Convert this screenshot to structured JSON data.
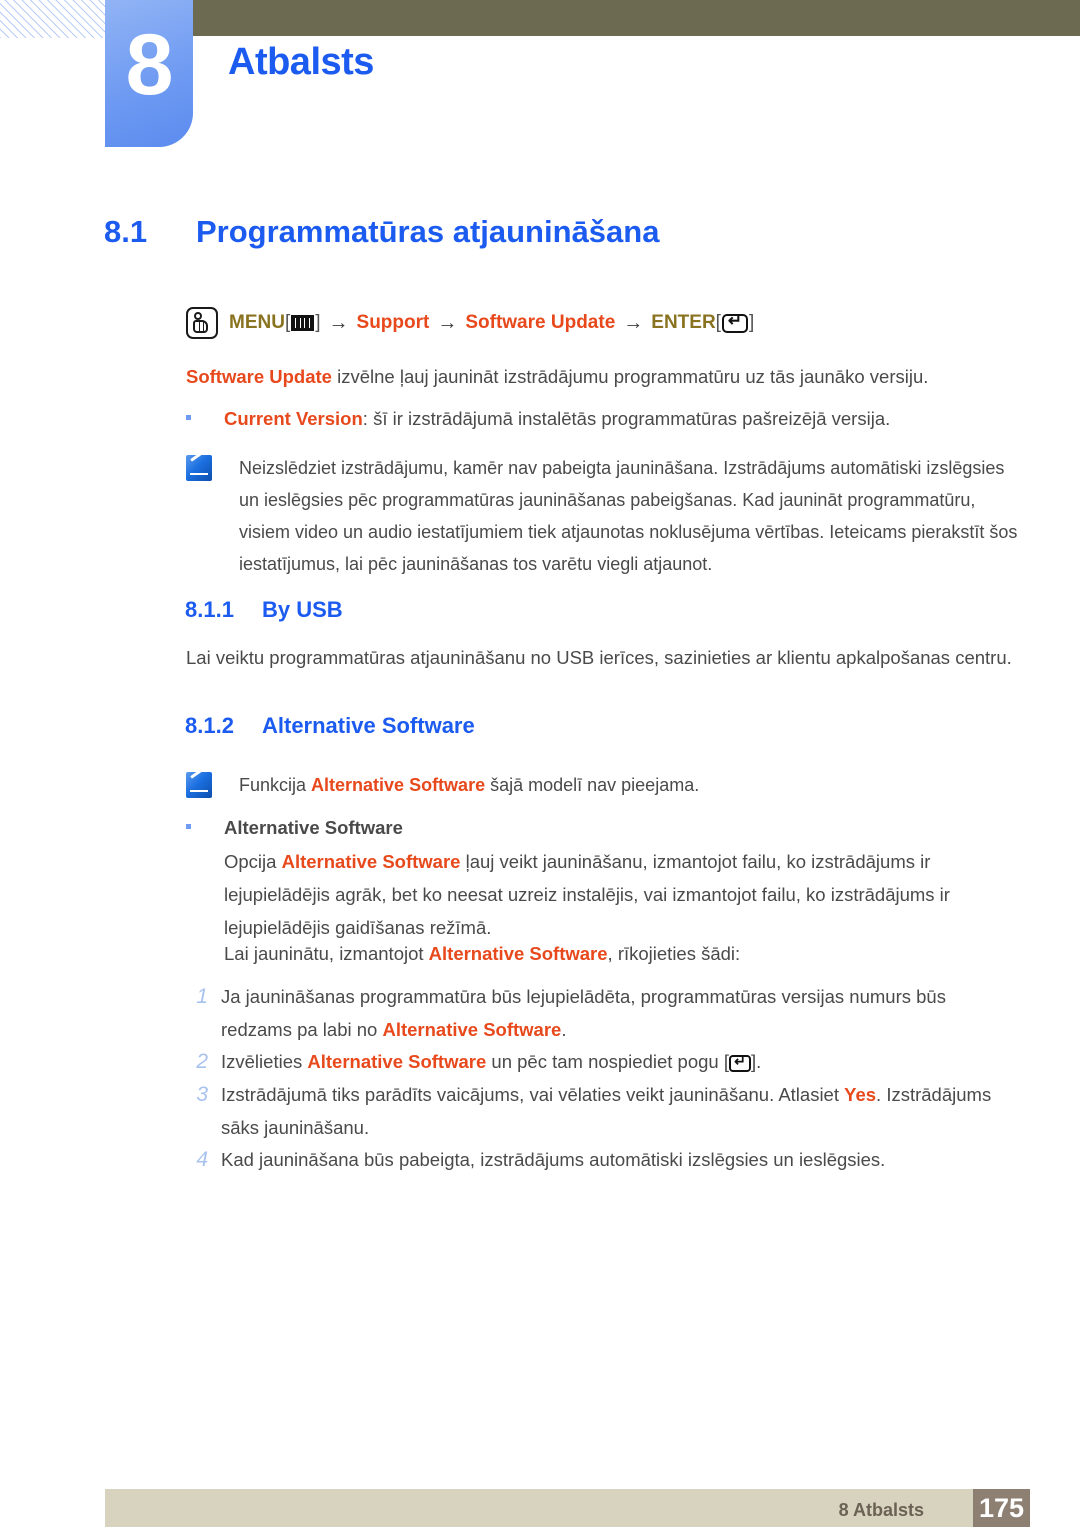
{
  "header": {
    "chapter_number": "8",
    "chapter_title": "Atbalsts"
  },
  "section": {
    "number": "8.1",
    "title": "Programmatūras atjaunināšana"
  },
  "menu_path": {
    "hand_icon": "hand-pointer-icon",
    "menu_label": "MENU",
    "menu_icon": "menu-bars-icon",
    "arrow": "→",
    "step1": "Support",
    "step2": "Software Update",
    "enter_label": "ENTER",
    "enter_icon": "enter-key-icon",
    "bracket_open": "[",
    "bracket_close": "]"
  },
  "intro": {
    "bold": "Software Update",
    "rest": " izvēlne ļauj jaunināt izstrādājumu programmatūru uz tās jaunāko versiju."
  },
  "bullet_current_version": {
    "bold": "Current Version",
    "rest": ": šī ir izstrādājumā instalētās programmatūras pašreizējā versija."
  },
  "note1": {
    "icon": "note-pen-icon",
    "text": "Neizslēdziet izstrādājumu, kamēr nav pabeigta jaunināšana. Izstrādājums automātiski izslēgsies un ieslēgsies pēc programmatūras jaunināšanas pabeigšanas. Kad jaunināt programmatūru, visiem video un audio iestatījumiem tiek atjaunotas noklusējuma vērtības. Ieteicams pierakstīt šos iestatījumus, lai pēc jaunināšanas tos varētu viegli atjaunot."
  },
  "subsection_usb": {
    "number": "8.1.1",
    "title": "By USB",
    "body": "Lai veiktu programmatūras atjaunināšanu no USB ierīces, sazinieties ar klientu apkalpošanas centru."
  },
  "subsection_alt": {
    "number": "8.1.2",
    "title": "Alternative Software"
  },
  "note2": {
    "icon": "note-pen-icon",
    "pre": "Funkcija ",
    "bold": "Alternative Software",
    "post": " šajā modelī nav pieejama."
  },
  "bullet_alt_software": {
    "label": "Alternative Software"
  },
  "alt_para1": {
    "pre": "Opcija ",
    "bold": "Alternative Software",
    "post": " ļauj veikt jaunināšanu, izmantojot failu, ko izstrādājums ir lejupielādējis agrāk, bet ko neesat uzreiz instalējis, vai izmantojot failu, ko izstrādājums ir lejupielādējis gaidīšanas režīmā."
  },
  "alt_para2": {
    "pre": "Lai jauninātu, izmantojot ",
    "bold": "Alternative Software",
    "post": ", rīkojieties šādi:"
  },
  "steps": [
    {
      "number": "1",
      "pre": "Ja jaunināšanas programmatūra būs lejupielādēta, programmatūras versijas numurs būs redzams pa labi no ",
      "bold": "Alternative Software",
      "post": "."
    },
    {
      "number": "2",
      "pre": "Izvēlieties ",
      "bold": "Alternative Software",
      "post": " un pēc tam nospiediet pogu [",
      "icon": "enter-key-icon",
      "tail": "]."
    },
    {
      "number": "3",
      "pre": "Izstrādājumā tiks parādīts vaicājums, vai vēlaties veikt jaunināšanu. Atlasiet ",
      "bold": "Yes",
      "post": ". Izstrādājums sāks jaunināšanu."
    },
    {
      "number": "4",
      "pre": "Kad jaunināšana būs pabeigta, izstrādājums automātiski izslēgsies un ieslēgsies.",
      "bold": "",
      "post": ""
    }
  ],
  "footer": {
    "label": "8 Atbalsts",
    "page": "175"
  },
  "colors": {
    "heading_blue": "#1c5bf0",
    "accent_orange": "#e8491c",
    "menu_olive": "#8a7320",
    "olive_bar": "#6d6a52",
    "footer_bar": "#d8d3bf",
    "footer_page_box": "#8d7f72",
    "chapter_blue": "#6f9bf2"
  }
}
